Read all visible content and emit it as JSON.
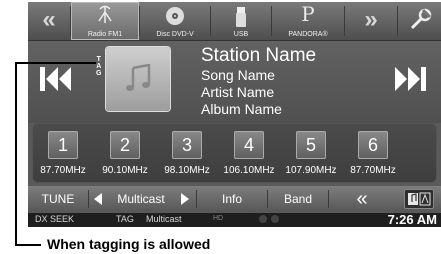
{
  "topbar": {
    "sources": [
      {
        "label": "Radio FM1",
        "icon": "antenna-icon"
      },
      {
        "label": "Disc DVD-V",
        "icon": "disc-icon"
      },
      {
        "label": "USB",
        "icon": "usb-icon"
      },
      {
        "label": "PANDORA®",
        "icon": "pandora-icon",
        "glyph": "P"
      }
    ],
    "left_arrow": "«",
    "right_arrow": "»",
    "setup_icon": "wrench-icon"
  },
  "info": {
    "tag_label": "T\nA\nG",
    "station": "Station Name",
    "song": "Song Name",
    "artist": "Artist Name",
    "album": "Album Name"
  },
  "presets": [
    {
      "num": "1",
      "freq": "87.70MHz"
    },
    {
      "num": "2",
      "freq": "90.10MHz"
    },
    {
      "num": "3",
      "freq": "98.10MHz"
    },
    {
      "num": "4",
      "freq": "106.10MHz"
    },
    {
      "num": "5",
      "freq": "107.90MHz"
    },
    {
      "num": "6",
      "freq": "87.70MHz"
    }
  ],
  "functions": {
    "tune": "TUNE",
    "multicast": "Multicast",
    "info": "Info",
    "band": "Band",
    "back": "«"
  },
  "status": {
    "dx_seek": "DX SEEK",
    "tag": "TAG",
    "multicast": "Multicast",
    "hd": "HD",
    "clock": "7:26 AM"
  },
  "callout": {
    "text": "When tagging is allowed"
  },
  "colors": {
    "screen_bg": "#5a5a5a",
    "status_bg": "#1e1e1e",
    "text": "#ffffff"
  }
}
